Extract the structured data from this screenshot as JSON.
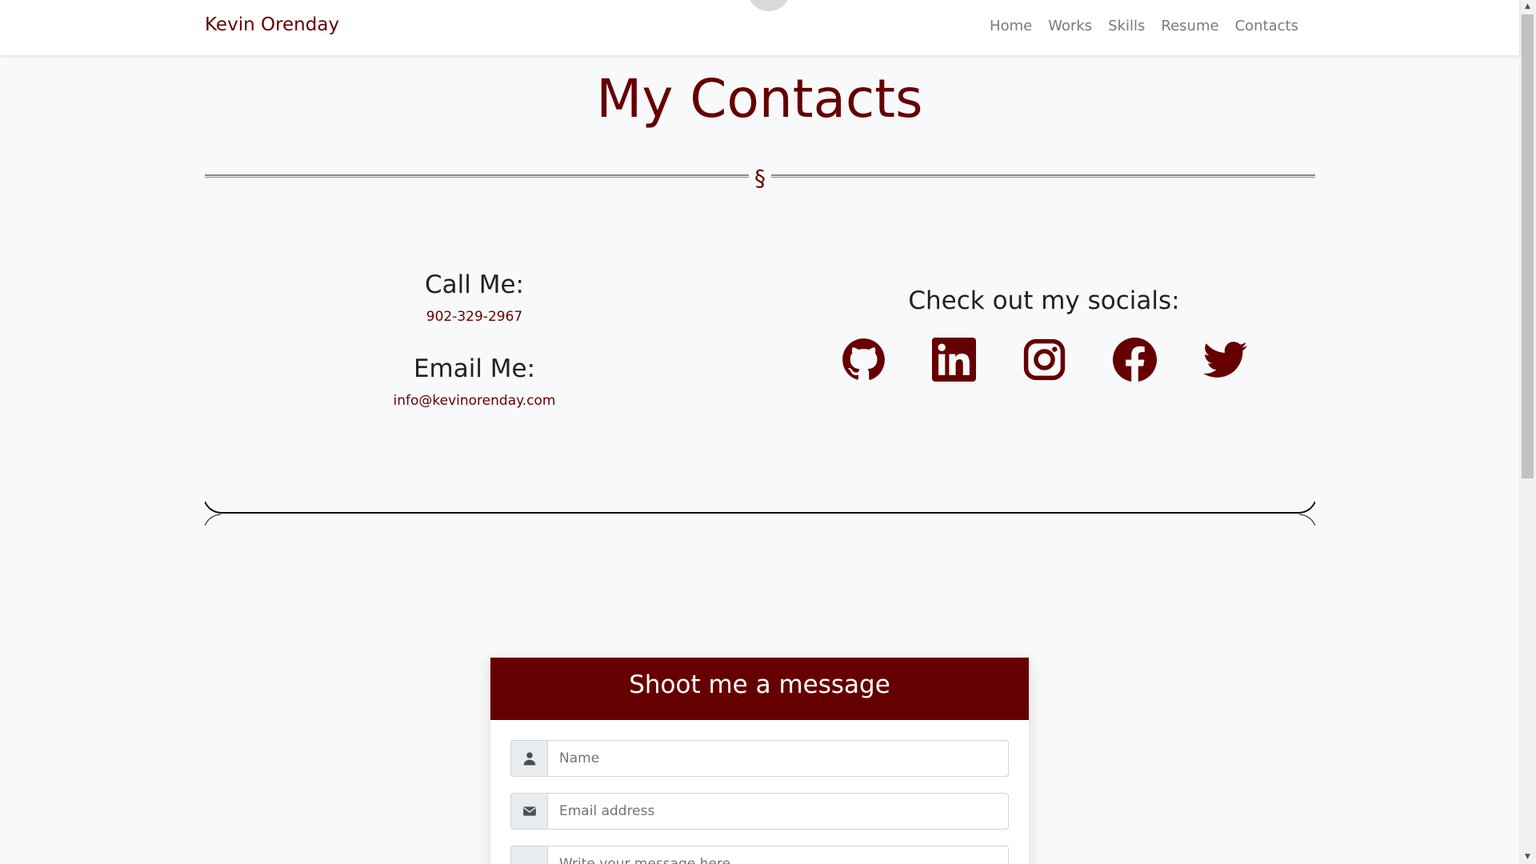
{
  "navbar": {
    "brand": "Kevin Orenday",
    "links": [
      "Home",
      "Works",
      "Skills",
      "Resume",
      "Contacts"
    ]
  },
  "page": {
    "title": "My Contacts",
    "section_mark": "§"
  },
  "contact": {
    "call_heading": "Call Me:",
    "phone": "902-329-2967",
    "email_heading": "Email Me:",
    "email": "info@kevinorenday.com"
  },
  "socials": {
    "heading": "Check out my socials:",
    "icons": [
      "github-icon",
      "linkedin-icon",
      "instagram-icon",
      "facebook-icon",
      "twitter-icon"
    ]
  },
  "message_form": {
    "title": "Shoot me a message",
    "name_placeholder": "Name",
    "email_placeholder": "Email address",
    "message_placeholder": "Write your message here"
  },
  "colors": {
    "accent": "#660000",
    "background": "#f8f9fa",
    "nav_link": "#7a7a7a"
  }
}
